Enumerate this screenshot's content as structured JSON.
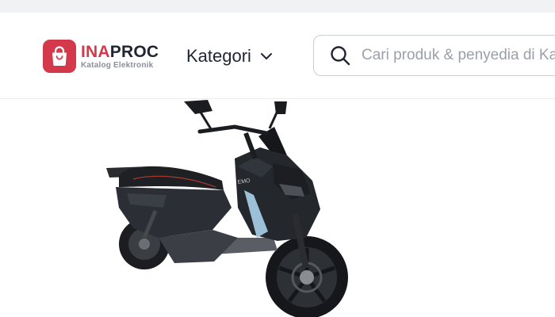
{
  "header": {
    "brand": {
      "name_accent": "INA",
      "name_rest": "PROC",
      "subtitle": "Katalog Elektronik",
      "icon": "shopping-bag-icon",
      "color": "#d4384b"
    },
    "category_label": "Kategori",
    "category_icon": "chevron-down-icon",
    "search": {
      "placeholder": "Cari produk & penyedia di Katalog",
      "icon": "search-icon"
    }
  },
  "product": {
    "image": "electric-scooter-photo",
    "brand_mark": "EMO",
    "colors": {
      "body": "#2b2e34",
      "accent": "#9cc0d8"
    }
  }
}
